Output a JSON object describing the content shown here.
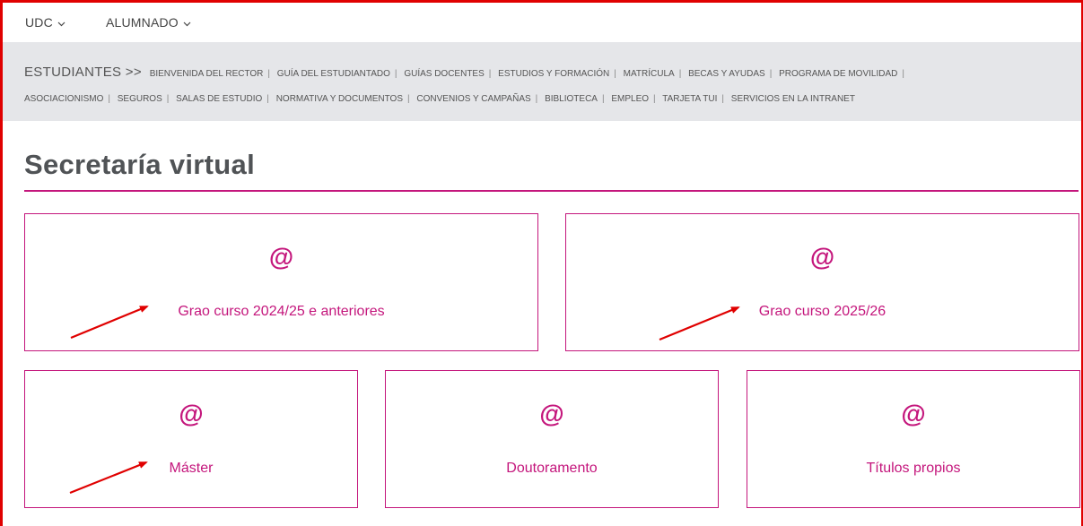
{
  "topnav": {
    "items": [
      {
        "label": "UDC"
      },
      {
        "label": "ALUMNADO"
      }
    ]
  },
  "subnav": {
    "heading": "ESTUDIANTES >>",
    "links": [
      "BIENVENIDA DEL RECTOR",
      "GUÍA DEL ESTUDIANTADO",
      "GUÍAS DOCENTES",
      "ESTUDIOS Y FORMACIÓN",
      "MATRÍCULA",
      "BECAS Y AYUDAS",
      "PROGRAMA DE MOVILIDAD",
      "ASOCIACIONISMO",
      "SEGUROS",
      "SALAS DE ESTUDIO",
      "NORMATIVA Y DOCUMENTOS",
      "CONVENIOS Y CAMPAÑAS",
      "BIBLIOTECA",
      "EMPLEO",
      "TARJETA TUI",
      "SERVICIOS EN LA INTRANET"
    ]
  },
  "page": {
    "title": "Secretaría virtual"
  },
  "cards": [
    {
      "icon": "@",
      "label": "Grao curso 2024/25 e anteriores"
    },
    {
      "icon": "@",
      "label": "Grao curso 2025/26"
    },
    {
      "icon": "@",
      "label": "Máster"
    },
    {
      "icon": "@",
      "label": "Doutoramento"
    },
    {
      "icon": "@",
      "label": "Títulos propios"
    }
  ],
  "colors": {
    "accent": "#c4167c",
    "annotation_frame": "#e00000",
    "annotation_arrow": "#e00000",
    "subnav_bg": "#e5e6e9"
  }
}
